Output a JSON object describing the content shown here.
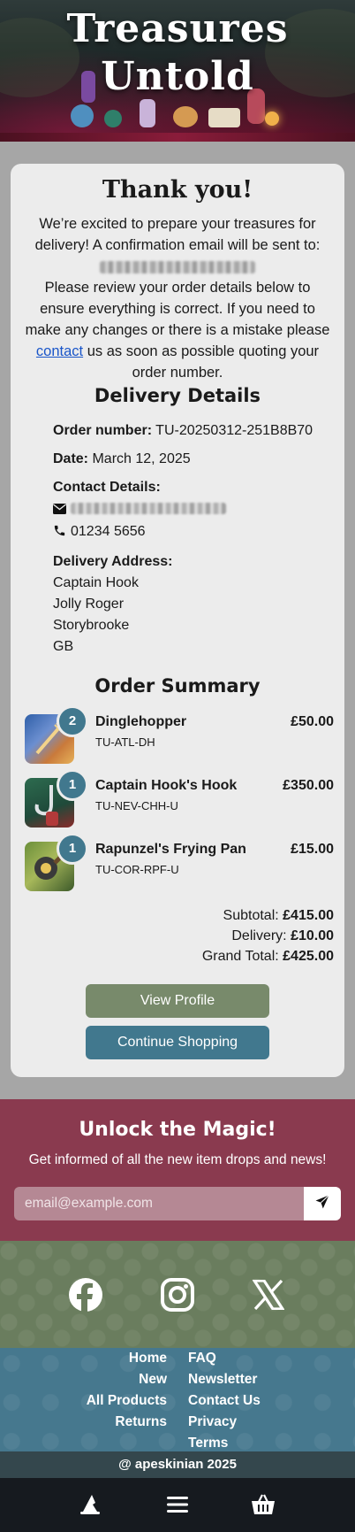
{
  "hero": {
    "title_line1": "Treasures",
    "title_line2": "Untold"
  },
  "confirmation": {
    "heading": "Thank you!",
    "intro": "We’re excited to prepare your treasures for delivery! A confirmation email will be sent to:",
    "review_text_1": "Please review your order details below to ensure everything is correct. If you need to make any changes or there is a mistake please",
    "contact_link": "contact",
    "review_text_2": "us as soon as possible quoting your order number."
  },
  "delivery": {
    "title": "Delivery Details",
    "order_number_label": "Order number:",
    "order_number": "TU-20250312-251B8B70",
    "date_label": "Date:",
    "date": "March 12, 2025",
    "contact_label": "Contact Details:",
    "phone": "01234 5656",
    "address_label": "Delivery Address:",
    "address_lines": [
      "Captain Hook",
      "Jolly Roger",
      "Storybrooke",
      "GB"
    ]
  },
  "summary": {
    "title": "Order Summary",
    "items": [
      {
        "qty": "2",
        "name": "Dinglehopper",
        "sku": "TU-ATL-DH",
        "price": "£50.00"
      },
      {
        "qty": "1",
        "name": "Captain Hook's Hook",
        "sku": "TU-NEV-CHH-U",
        "price": "£350.00"
      },
      {
        "qty": "1",
        "name": "Rapunzel's Frying Pan",
        "sku": "TU-COR-RPF-U",
        "price": "£15.00"
      }
    ],
    "subtotal_label": "Subtotal:",
    "subtotal": "£415.00",
    "delivery_label": "Delivery:",
    "delivery": "£10.00",
    "grand_total_label": "Grand Total:",
    "grand_total": "£425.00"
  },
  "actions": {
    "view_profile": "View Profile",
    "continue_shopping": "Continue Shopping"
  },
  "newsletter": {
    "title": "Unlock the Magic!",
    "subtitle": "Get informed of all the new item drops and news!",
    "placeholder": "email@example.com"
  },
  "social": {
    "icons": [
      "facebook-icon",
      "instagram-icon",
      "x-icon"
    ]
  },
  "footer_links": {
    "left": [
      "Home",
      "New",
      "All Products",
      "Returns"
    ],
    "right": [
      "FAQ",
      "Newsletter",
      "Contact Us",
      "Privacy",
      "Terms"
    ]
  },
  "copyright": "@ apeskinian 2025",
  "colors": {
    "sage": "#788a6b",
    "teal": "#41788e",
    "burgundy": "#8a3a4f",
    "footer_green": "#6a7d5e",
    "footer_blue": "#46788e",
    "nav_dark": "#161a1f"
  }
}
